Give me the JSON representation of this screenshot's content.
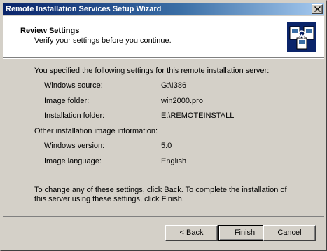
{
  "window": {
    "title": "Remote Installation Services Setup Wizard"
  },
  "header": {
    "title": "Review Settings",
    "subtitle": "Verify your settings before you continue."
  },
  "body": {
    "intro": "You specified the following settings for this remote installation server:",
    "settings": [
      {
        "label": "Windows source:",
        "value": "G:\\I386"
      },
      {
        "label": "Image folder:",
        "value": "win2000.pro"
      },
      {
        "label": "Installation folder:",
        "value": "E:\\REMOTEINSTALL"
      }
    ],
    "other_heading": "Other installation image information:",
    "image_info": [
      {
        "label": "Windows version:",
        "value": "5.0"
      },
      {
        "label": "Image language:",
        "value": "English"
      }
    ],
    "footer_note": "To change any of these settings, click Back. To complete the installation of this server using these settings, click Finish."
  },
  "buttons": {
    "back": "< Back",
    "finish": "Finish",
    "cancel": "Cancel"
  },
  "icons": {
    "close": "close-icon",
    "wizard": "wizard-icon"
  }
}
